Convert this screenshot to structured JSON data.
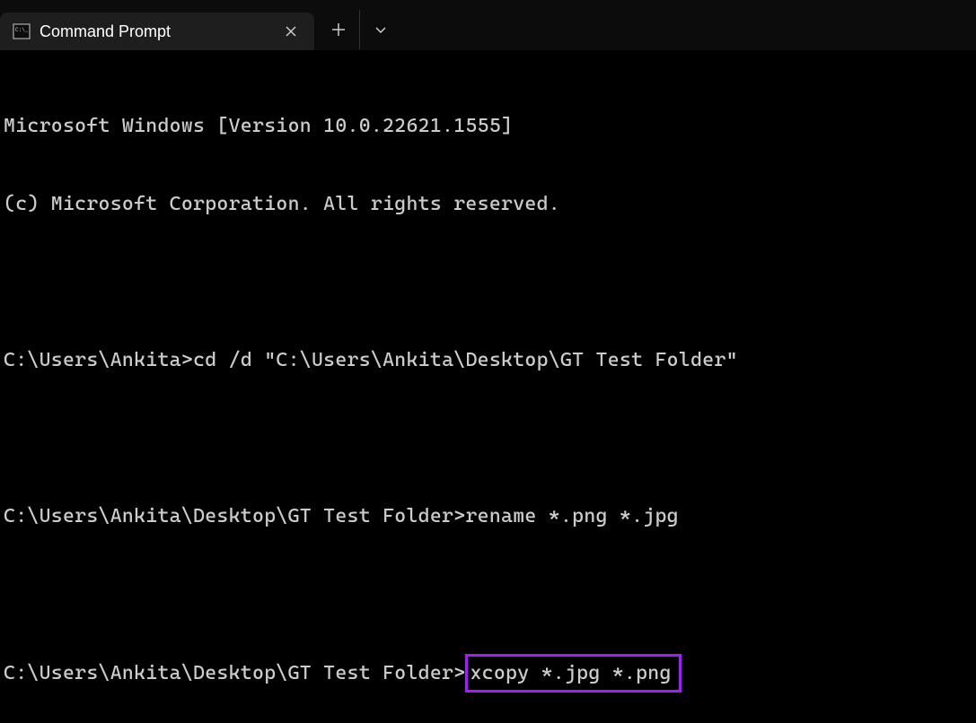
{
  "titleBar": {
    "tabTitle": "Command Prompt",
    "closeLabel": "✕",
    "newTabLabel": "+"
  },
  "terminal": {
    "line1": "Microsoft Windows [Version 10.0.22621.1555]",
    "line2": "(c) Microsoft Corporation. All rights reserved.",
    "line4_prompt": "C:\\Users\\Ankita>",
    "line4_cmd": "cd /d \"C:\\Users\\Ankita\\Desktop\\GT Test Folder\"",
    "line6_prompt": "C:\\Users\\Ankita\\Desktop\\GT Test Folder>",
    "line6_cmd": "rename *.png *.jpg",
    "line8_prompt": "C:\\Users\\Ankita\\Desktop\\GT Test Folder>",
    "line8_cmd": "xcopy *.jpg *.png"
  },
  "colors": {
    "highlight": "#a020f0",
    "text": "#cccccc",
    "background": "#000000"
  }
}
